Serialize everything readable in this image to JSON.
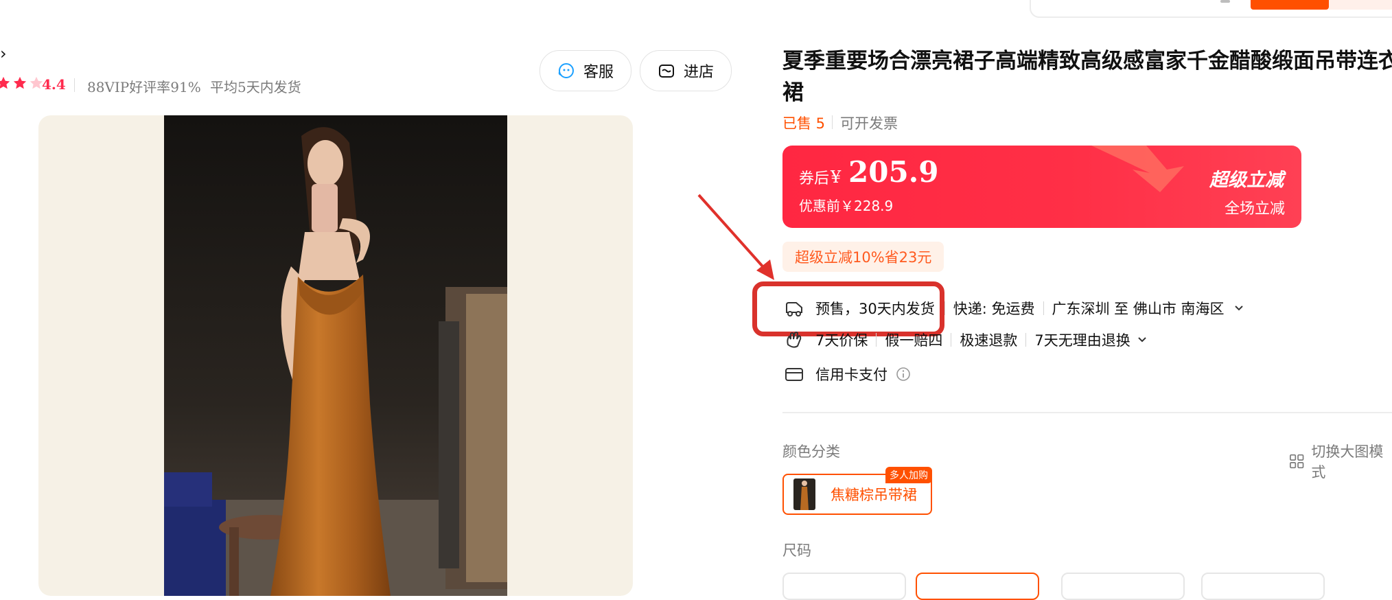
{
  "store": {
    "chevron": "›",
    "rating": "4.4",
    "vip_rate": "88VIP好评率91%",
    "ship_avg": "平均5天内发货",
    "service_button": "客服",
    "shop_button": "进店"
  },
  "product": {
    "title_line1": "夏季重要场合漂亮裙子高端精致高级感富家千金醋酸缎面吊带连衣",
    "title_line2": "裙",
    "sold": "已售 5",
    "invoice": "可开发票"
  },
  "price": {
    "after_coupon_label": "券后",
    "currency": "¥",
    "value": "205.9",
    "before_discount": "优惠前￥228.9",
    "promo_title": "超级立减",
    "promo_sub": "全场立减"
  },
  "promo_tag": "超级立减10%省23元",
  "delivery": {
    "presale": "预售，30天内发货",
    "express": "快递: 免运费",
    "route": "广东深圳 至 佛山市 南海区"
  },
  "guarantees": {
    "items": [
      "7天价保",
      "假一赔四",
      "极速退款",
      "7天无理由退换"
    ]
  },
  "payment": {
    "credit": "信用卡支付"
  },
  "color_section": {
    "label": "颜色分类",
    "switch_view": "切换大图模式",
    "sku_name": "焦糖棕吊带裙",
    "sku_badge": "多人加购"
  },
  "size_section": {
    "label": "尺码"
  },
  "colors": {
    "accent": "#ff5000",
    "price_red": "#ff2742",
    "rating_red": "#ff2a4d",
    "highlight": "#d9322c"
  }
}
